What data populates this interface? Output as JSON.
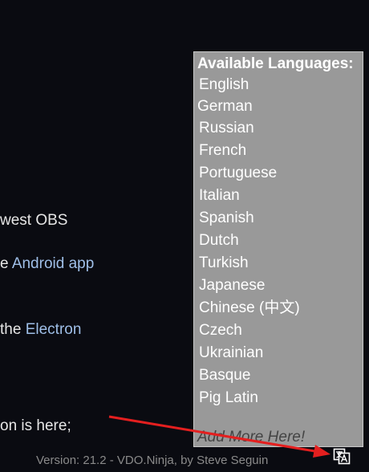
{
  "background": {
    "line1": "west OBS",
    "line2_prefix": "e ",
    "line2_link": "Android app",
    "line3_prefix": "the ",
    "line3_link": "Electron",
    "line4": "on is here;"
  },
  "language_panel": {
    "title": "Available Languages:",
    "languages": [
      "English",
      "German",
      "Russian",
      "French",
      "Portuguese",
      "Italian",
      "Spanish",
      "Dutch",
      "Turkish",
      "Japanese",
      "Chinese (中文)",
      "Czech",
      "Ukrainian",
      "Basque",
      "Pig Latin"
    ],
    "add_more": "Add More Here!"
  },
  "footer": {
    "version": "Version: 21.2 - VDO.Ninja, by Steve Seguin"
  },
  "icons": {
    "translate": "translate-icon",
    "arrow": "red-arrow-icon"
  },
  "colors": {
    "background": "#0a0b11",
    "panel": "#999999",
    "link": "#9fbfe8",
    "arrow": "#e41f1f"
  }
}
